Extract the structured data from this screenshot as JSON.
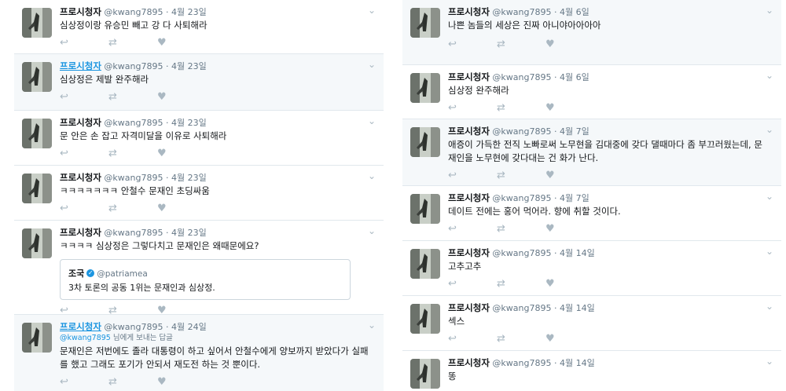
{
  "colors": {
    "name_link": "#1b95e0",
    "muted": "#657786",
    "icon": "#aab8c2",
    "highlight_bg": "#f5f8fa"
  },
  "icons": {
    "reply": "reply-icon",
    "retweet": "retweet-icon",
    "like": "heart-icon",
    "menu": "chevron-down-icon"
  },
  "left": [
    {
      "name": "프로시청자",
      "handle": "@kwang7895",
      "date": "4월 23일",
      "text": "심상정이랑 유승민 빼고 강 다 사퇴해라"
    },
    {
      "name": "프로시청자",
      "handle": "@kwang7895",
      "date": "4월 23일",
      "text": "심상정은 제발 완주해라"
    },
    {
      "name": "프로시청자",
      "handle": "@kwang7895",
      "date": "4월 23일",
      "text": "문 안은 손 잡고 자격미달을 이유로 사퇴해라"
    },
    {
      "name": "프로시청자",
      "handle": "@kwang7895",
      "date": "4월 23일",
      "text": "ㅋㅋㅋㅋㅋㅋㅋ 안철수 문재인 초딩싸움"
    },
    {
      "name": "프로시청자",
      "handle": "@kwang7895",
      "date": "4월 23일",
      "text": "ㅋㅋㅋㅋ 심상정은 그렇다치고 문재인은 왜때문에요?",
      "quote": {
        "name": "조국",
        "handle": "@patriamea",
        "text": "3차 토론의 공동 1위는 문재인과 심상정."
      }
    },
    {
      "name": "프로시청자",
      "handle": "@kwang7895",
      "date": "4월 24일",
      "reply_handle": "@kwang7895",
      "reply_suffix": "님에게 보내는 답글",
      "text": "문재인은 저번에도 졸라 대통령이 하고 싶어서 안철수에게 양보까지 받았다가 실패를 했고 그래도 포기가 안되서 재도전 하는 것 뿐이다."
    }
  ],
  "right": [
    {
      "name": "프로시청자",
      "handle": "@kwang7895",
      "date": "4월 6일",
      "text": "나쁜 놈들의 세상은 진짜 아니야아아아아"
    },
    {
      "name": "프로시청자",
      "handle": "@kwang7895",
      "date": "4월 6일",
      "text": "심상정 완주해라"
    },
    {
      "name": "프로시청자",
      "handle": "@kwang7895",
      "date": "4월 7일",
      "text": "애증이 가득한 전직 노빠로써 노무현을 김대중에 갖다 댈때마다 좀 부끄러웠는데, 문재인을 노무현에 갖다대는 건 화가 난다."
    },
    {
      "name": "프로시청자",
      "handle": "@kwang7895",
      "date": "4월 7일",
      "text": "데이트 전에는 홍어 먹어라. 향에 취할 것이다."
    },
    {
      "name": "프로시청자",
      "handle": "@kwang7895",
      "date": "4월 14일",
      "text": "고추고추"
    },
    {
      "name": "프로시청자",
      "handle": "@kwang7895",
      "date": "4월 14일",
      "text": "섹스"
    },
    {
      "name": "프로시청자",
      "handle": "@kwang7895",
      "date": "4월 14일",
      "text": "똥"
    }
  ]
}
